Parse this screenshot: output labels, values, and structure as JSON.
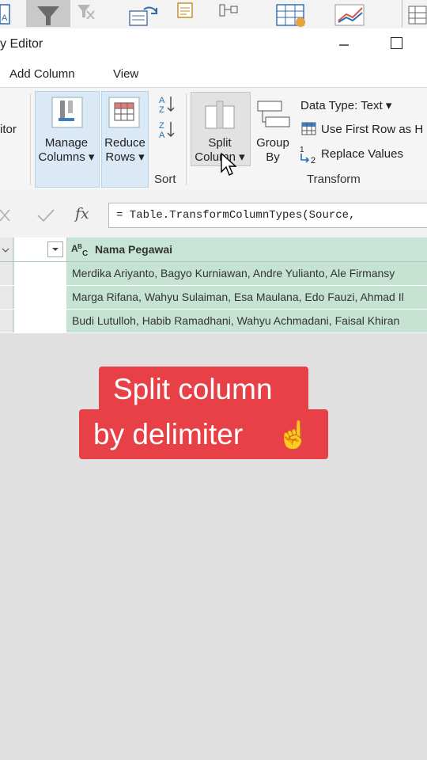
{
  "window": {
    "title": "y Editor"
  },
  "tabs": [
    {
      "label": "Add Column"
    },
    {
      "label": "View"
    }
  ],
  "ribbon": {
    "editor_label": "itor",
    "manage_columns": {
      "line1": "Manage",
      "line2": "Columns ▾"
    },
    "reduce_rows": {
      "line1": "Reduce",
      "line2": "Rows ▾"
    },
    "sort_group": "Sort",
    "split_column": {
      "line1": "Split",
      "line2": "Column ▾"
    },
    "group_by": {
      "line1": "Group",
      "line2": "By"
    },
    "data_type": "Data Type: Text ▾",
    "use_first_row": "Use First Row as H",
    "replace_values": "Replace Values",
    "transform_group": "Transform"
  },
  "formula": {
    "fx": "fx",
    "text": "= Table.TransformColumnTypes(Source,"
  },
  "grid": {
    "column_header": "Nama Pegawai",
    "column_type_icon": "ABC",
    "rows": [
      "Merdika Ariyanto, Bagyo Kurniawan, Andre Yulianto, Ale Firmansy",
      "Marga Rifana, Wahyu Sulaiman, Esa Maulana, Edo Fauzi, Ahmad Il",
      "Budi Lutulloh, Habib Ramadhani, Wahyu Achmadani, Faisal Khiran"
    ]
  },
  "overlay": {
    "line1": "Split column",
    "line2": "by delimiter",
    "emoji": "☝️"
  },
  "colors": {
    "accent_red": "#e84047",
    "grid_green": "#c5e2d3",
    "ribbon_highlight": "#dbe9f6"
  }
}
